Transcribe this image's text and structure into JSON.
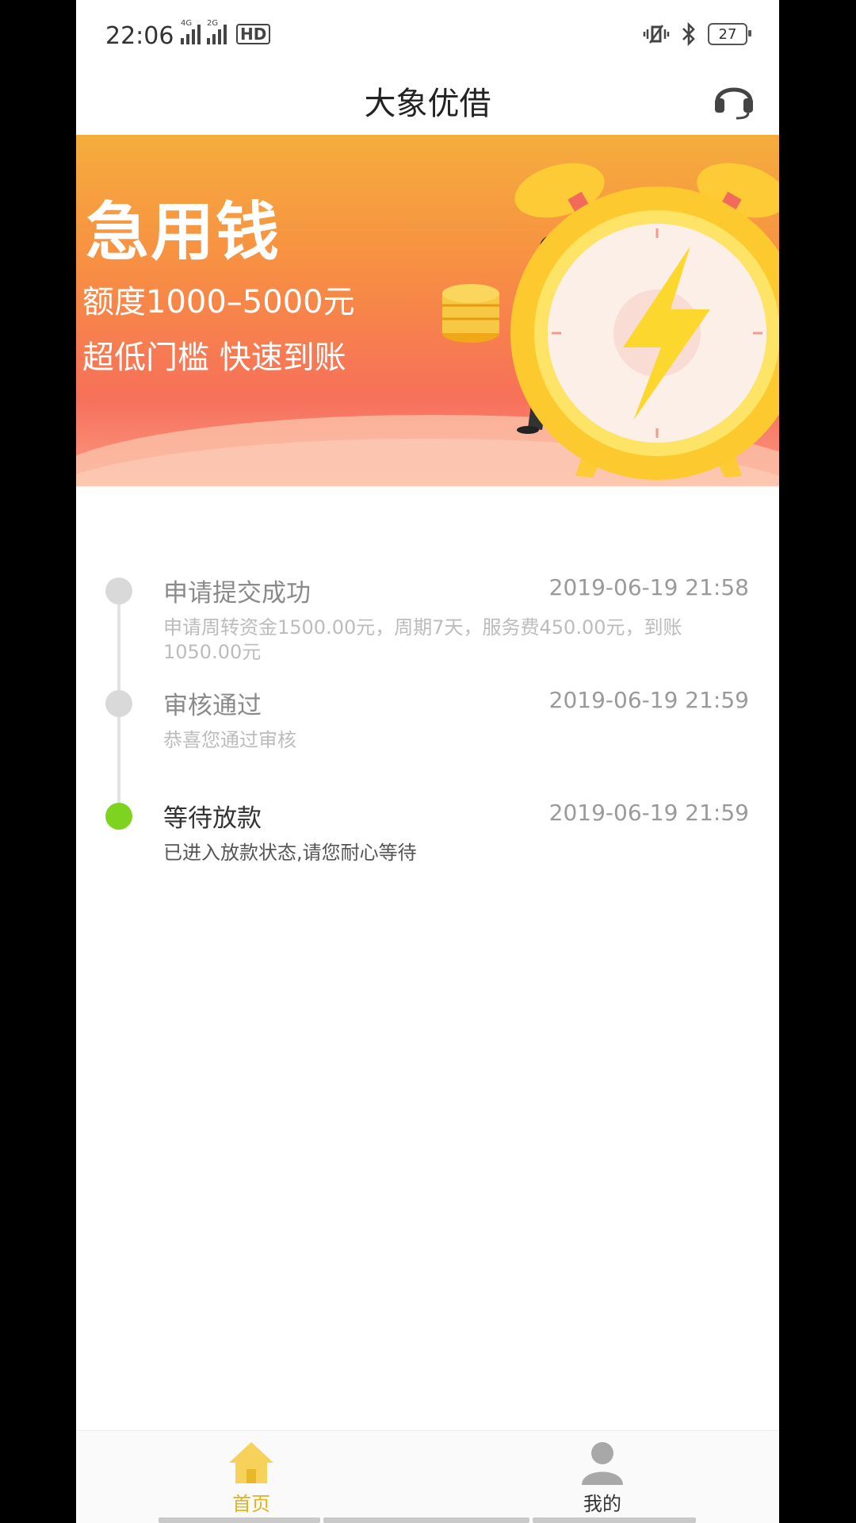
{
  "status_bar": {
    "time": "22:06",
    "signal1_label": "4G",
    "signal2_label": "2G",
    "hd_label": "HD",
    "battery": "27"
  },
  "header": {
    "title": "大象优借",
    "support_icon": "headset-icon"
  },
  "banner": {
    "title": "急用钱",
    "line1": "额度1000–5000元",
    "line2": "超低门槛 快速到账"
  },
  "timeline": {
    "steps": [
      {
        "title": "申请提交成功",
        "time": "2019-06-19 21:58",
        "desc": "申请周转资金1500.00元，周期7天，服务费450.00元，到账1050.00元",
        "state": "done"
      },
      {
        "title": "审核通过",
        "time": "2019-06-19 21:59",
        "desc": "恭喜您通过审核",
        "state": "done"
      },
      {
        "title": "等待放款",
        "time": "2019-06-19 21:59",
        "desc": "已进入放款状态,请您耐心等待",
        "state": "current"
      }
    ]
  },
  "bottom_nav": {
    "home_label": "首页",
    "mine_label": "我的"
  },
  "colors": {
    "active_dot": "#7ed321",
    "home_active": "#e3b418"
  }
}
